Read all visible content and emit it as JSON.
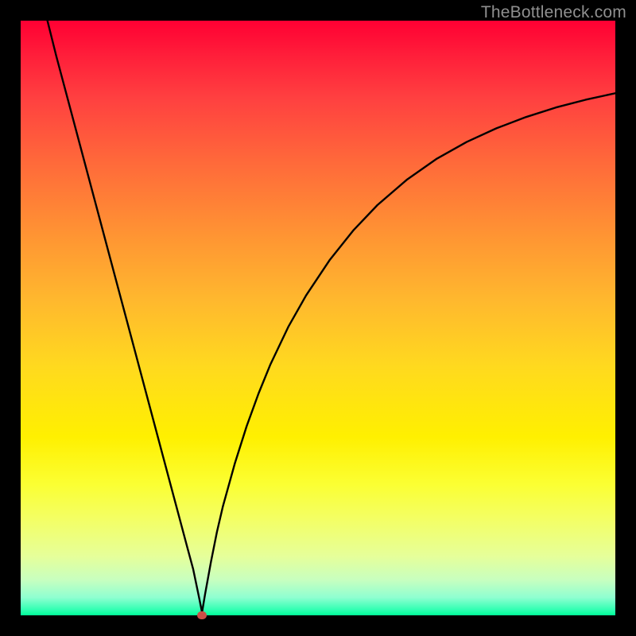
{
  "watermark": "TheBottleneck.com",
  "chart_data": {
    "type": "line",
    "title": "",
    "xlabel": "",
    "ylabel": "",
    "xlim": [
      0,
      100
    ],
    "ylim": [
      0,
      100
    ],
    "grid": false,
    "marker": {
      "x": 30.5,
      "y": 0
    },
    "x": [
      4,
      6,
      8,
      10,
      12,
      14,
      16,
      18,
      20,
      22,
      24,
      26,
      28,
      29,
      30,
      30.5,
      31,
      32,
      33,
      34,
      36,
      38,
      40,
      42,
      45,
      48,
      52,
      56,
      60,
      65,
      70,
      75,
      80,
      85,
      90,
      95,
      100
    ],
    "y": [
      102,
      94,
      86.5,
      79,
      71.5,
      64,
      56.5,
      49,
      41.5,
      34,
      26.5,
      19,
      11.5,
      7.8,
      3.0,
      0.5,
      3.5,
      9.0,
      14.0,
      18.3,
      25.5,
      31.8,
      37.3,
      42.2,
      48.5,
      53.8,
      59.8,
      64.8,
      69.0,
      73.3,
      76.8,
      79.6,
      81.9,
      83.8,
      85.4,
      86.7,
      87.8
    ]
  }
}
